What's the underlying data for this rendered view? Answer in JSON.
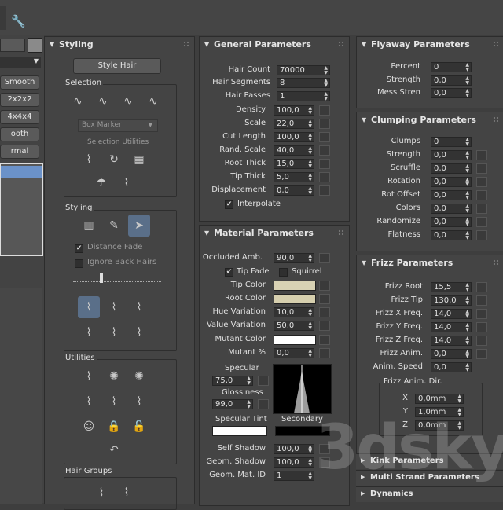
{
  "left_column": {
    "buttons": [
      "Smooth",
      "2x2x2",
      "4x4x4",
      "ooth",
      "rmal"
    ]
  },
  "styling": {
    "title": "Styling",
    "style_hair": "Style Hair",
    "selection_title": "Selection",
    "box_marker": "Box Marker",
    "selection_utilities": "Selection Utilities",
    "styling_title": "Styling",
    "distance_fade": "Distance Fade",
    "ignore_back_hairs": "Ignore Back Hairs",
    "utilities_title": "Utilities",
    "hair_groups_title": "Hair Groups"
  },
  "general": {
    "title": "General Parameters",
    "rows": [
      {
        "label": "Hair Count",
        "value": "70000"
      },
      {
        "label": "Hair Segments",
        "value": "8"
      },
      {
        "label": "Hair Passes",
        "value": "1"
      },
      {
        "label": "Density",
        "value": "100,0"
      },
      {
        "label": "Scale",
        "value": "22,0"
      },
      {
        "label": "Cut Length",
        "value": "100,0"
      },
      {
        "label": "Rand. Scale",
        "value": "40,0"
      },
      {
        "label": "Root Thick",
        "value": "15,0"
      },
      {
        "label": "Tip Thick",
        "value": "5,0"
      },
      {
        "label": "Displacement",
        "value": "0,0"
      }
    ],
    "interpolate": "Interpolate"
  },
  "material": {
    "title": "Material Parameters",
    "occluded_amb_label": "Occluded Amb.",
    "occluded_amb_value": "90,0",
    "tip_fade": "Tip Fade",
    "squirrel": "Squirrel",
    "tip_color": "Tip Color",
    "root_color": "Root Color",
    "hue_variation_label": "Hue Variation",
    "hue_variation_value": "10,0",
    "value_variation_label": "Value Variation",
    "value_variation_value": "50,0",
    "mutant_color": "Mutant Color",
    "mutant_pct_label": "Mutant %",
    "mutant_pct_value": "0,0",
    "specular_label": "Specular",
    "specular_value": "75,0",
    "glossiness_label": "Glossiness",
    "glossiness_value": "99,0",
    "specular_tint": "Specular Tint",
    "secondary": "Secondary",
    "self_shadow_label": "Self Shadow",
    "self_shadow_value": "100,0",
    "geom_shadow_label": "Geom. Shadow",
    "geom_shadow_value": "100,0",
    "geom_mat_id_label": "Geom. Mat. ID",
    "geom_mat_id_value": "1",
    "colors": {
      "tip": "#d8d2b4",
      "root": "#d6cfae",
      "mutant": "#ffffff",
      "spec_tint": "#ffffff",
      "secondary": "#000000"
    }
  },
  "flyaway": {
    "title": "Flyaway Parameters",
    "rows": [
      {
        "label": "Percent",
        "value": "0"
      },
      {
        "label": "Strength",
        "value": "0,0"
      },
      {
        "label": "Mess Stren",
        "value": "0,0"
      }
    ]
  },
  "clumping": {
    "title": "Clumping Parameters",
    "rows": [
      {
        "label": "Clumps",
        "value": "0"
      },
      {
        "label": "Strength",
        "value": "0,0"
      },
      {
        "label": "Scruffle",
        "value": "0,0"
      },
      {
        "label": "Rotation",
        "value": "0,0"
      },
      {
        "label": "Rot Offset",
        "value": "0,0"
      },
      {
        "label": "Colors",
        "value": "0,0"
      },
      {
        "label": "Randomize",
        "value": "0,0"
      },
      {
        "label": "Flatness",
        "value": "0,0"
      }
    ]
  },
  "frizz": {
    "title": "Frizz Parameters",
    "rows": [
      {
        "label": "Frizz Root",
        "value": "15,5"
      },
      {
        "label": "Frizz Tip",
        "value": "130,0"
      },
      {
        "label": "Frizz X Freq.",
        "value": "14,0"
      },
      {
        "label": "Frizz Y Freq.",
        "value": "14,0"
      },
      {
        "label": "Frizz Z Freq.",
        "value": "14,0"
      },
      {
        "label": "Frizz Anim.",
        "value": "0,0"
      },
      {
        "label": "Anim. Speed",
        "value": "0,0"
      }
    ],
    "anim_dir_title": "Frizz Anim. Dir.",
    "dir": [
      {
        "label": "X",
        "value": "0,0mm"
      },
      {
        "label": "Y",
        "value": "1,0mm"
      },
      {
        "label": "Z",
        "value": "0,0mm"
      }
    ]
  },
  "collapsed": [
    "Kink Parameters",
    "Multi Strand Parameters",
    "Dynamics"
  ],
  "watermark": "3dsky"
}
